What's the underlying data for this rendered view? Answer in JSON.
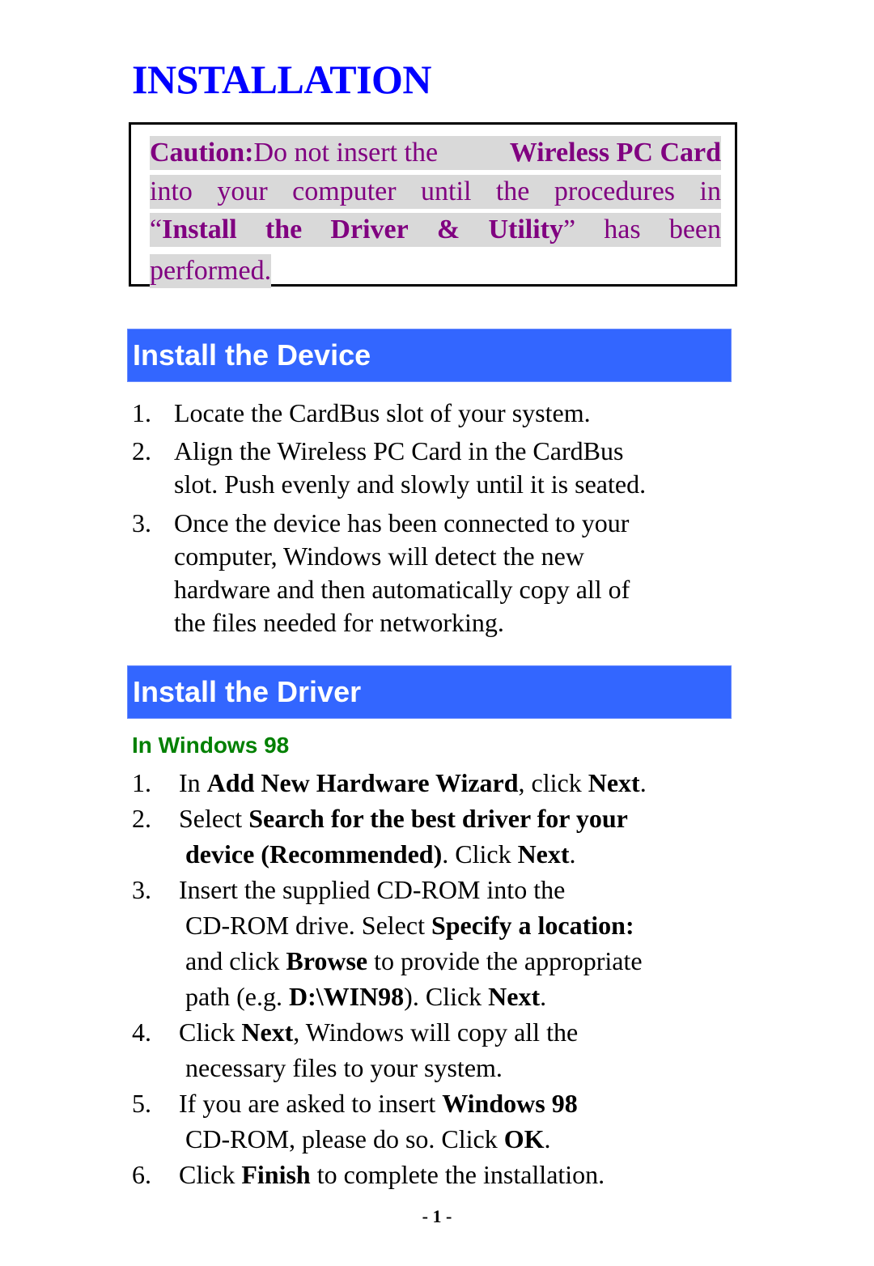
{
  "title": "INSTALLATION",
  "caution": {
    "label": "Caution:",
    "lines": [
      [
        "Caution:",
        "Do not insert the",
        "Wireless PC Card"
      ],
      [
        "into",
        "your",
        "computer",
        "until",
        "the",
        "procedures",
        "in"
      ],
      [
        "“Install",
        "the",
        "Driver",
        "&",
        "Utility”",
        "has",
        "been"
      ],
      [
        "performed."
      ]
    ],
    "text_color": "#800080",
    "highlight_color": "#d9d9d9"
  },
  "sections": [
    {
      "heading": "Install the Device",
      "steps": [
        {
          "num": "1.",
          "lines": [
            "Locate the CardBus slot of your system."
          ]
        },
        {
          "num": "2.",
          "lines": [
            "Align the Wireless PC Card in the CardBus",
            "slot. Push evenly and slowly until it is seated."
          ]
        },
        {
          "num": "3.",
          "lines": [
            "Once the device has been connected to your",
            "computer, Windows will detect the new",
            "hardware and then automatically copy all of",
            "the files needed for networking."
          ]
        }
      ]
    },
    {
      "heading": "Install the Driver",
      "subheading": "In Windows 98",
      "steps": [
        {
          "num": "1.",
          "lines": [
            [
              [
                "In ",
                false
              ],
              [
                "Add New Hardware Wizard",
                true
              ],
              [
                ", click ",
                false
              ],
              [
                "Next",
                true
              ],
              [
                ".",
                false
              ]
            ]
          ]
        },
        {
          "num": "2.",
          "lines": [
            [
              [
                "Select ",
                false
              ],
              [
                "Search for the best driver for your",
                true
              ]
            ],
            [
              [
                "device (Recommended)",
                true
              ],
              [
                ". Click ",
                false
              ],
              [
                "Next",
                true
              ],
              [
                ".",
                false
              ]
            ]
          ]
        },
        {
          "num": "3.",
          "lines": [
            [
              [
                "Insert the supplied CD-ROM into the",
                false
              ]
            ],
            [
              [
                "CD-ROM drive. Select ",
                false
              ],
              [
                "Specify a location:",
                true
              ]
            ],
            [
              [
                "and click ",
                false
              ],
              [
                "Browse",
                true
              ],
              [
                " to provide the appropriate",
                false
              ]
            ],
            [
              [
                "path (e.g. ",
                false
              ],
              [
                "D:\\WIN98",
                true
              ],
              [
                "). Click ",
                false
              ],
              [
                "Next",
                true
              ],
              [
                ".",
                false
              ]
            ]
          ]
        },
        {
          "num": "4.",
          "lines": [
            [
              [
                "Click ",
                false
              ],
              [
                "Next",
                true
              ],
              [
                ", Windows will copy all the",
                false
              ]
            ],
            [
              [
                "necessary files to your system.",
                false
              ]
            ]
          ]
        },
        {
          "num": "5.",
          "lines": [
            [
              [
                "If you are asked to insert ",
                false
              ],
              [
                "Windows 98",
                true
              ]
            ],
            [
              [
                "CD-ROM, please do so. Click ",
                false
              ],
              [
                "OK",
                true
              ],
              [
                ".",
                false
              ]
            ]
          ]
        },
        {
          "num": "6.",
          "lines": [
            [
              [
                "Click ",
                false
              ],
              [
                "Finish",
                true
              ],
              [
                " to complete the installation.",
                false
              ]
            ]
          ]
        }
      ]
    }
  ],
  "page_number": "- 1 -",
  "colors": {
    "title": "#0000ff",
    "section_bar": "#3366ff",
    "subheading": "#008000"
  }
}
